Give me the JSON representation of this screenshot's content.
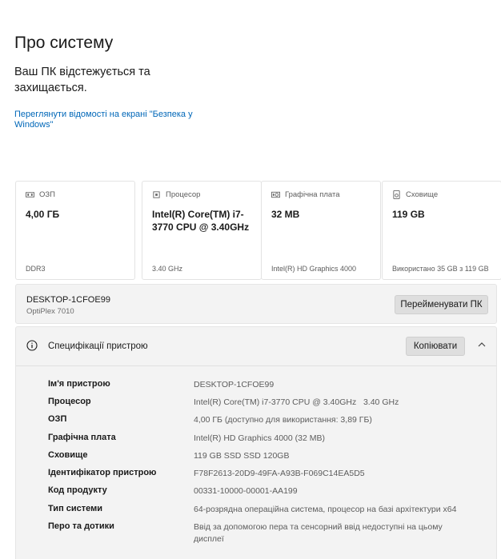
{
  "page": {
    "title": "Про систему",
    "protection_text": "Ваш ПК відстежується та захищається.",
    "security_link": "Переглянути відомості на екрані \"Безпека у Windows\""
  },
  "cards": [
    {
      "label": "ОЗП",
      "icon": "ram-icon",
      "value": "4,00 ГБ",
      "sub": "DDR3"
    },
    {
      "label": "Процесор",
      "icon": "processor-icon",
      "value": "Intel(R) Core(TM) i7-3770 CPU @ 3.40GHz",
      "sub": "3.40 GHz"
    },
    {
      "label": "Графічна плата",
      "icon": "graphics-card-icon",
      "value": "32 MB",
      "sub": "Intel(R) HD Graphics 4000"
    },
    {
      "label": "Сховище",
      "icon": "storage-icon",
      "value": "119 GB",
      "sub": "Використано 35 GB з 119 GB"
    }
  ],
  "device": {
    "name": "DESKTOP-1CFOE99",
    "model": "OptiPlex 7010",
    "rename_label": "Перейменувати ПК"
  },
  "specs": {
    "title": "Специфікації пристрою",
    "copy_label": "Копіювати",
    "rows": [
      {
        "label": "Ім'я пристрою",
        "value": "DESKTOP-1CFOE99"
      },
      {
        "label": "Процесор",
        "value": "Intel(R) Core(TM) i7-3770 CPU @ 3.40GHz   3.40 GHz"
      },
      {
        "label": "ОЗП",
        "value": "4,00 ГБ (доступно для використання: 3,89 ГБ)"
      },
      {
        "label": "Графічна плата",
        "value": "Intel(R) HD Graphics 4000 (32 MB)"
      },
      {
        "label": "Сховище",
        "value": "119 GB SSD SSD 120GB"
      },
      {
        "label": "Ідентифікатор пристрою",
        "value": "F78F2613-20D9-49FA-A93B-F069C14EA5D5"
      },
      {
        "label": "Код продукту",
        "value": "00331-10000-00001-AA199"
      },
      {
        "label": "Тип системи",
        "value": "64-розрядна операційна система, процесор на базі архітектури x64"
      },
      {
        "label": "Перо та дотики",
        "value": "Ввід за допомогою пера та сенсорний ввід недоступні на цьому дисплеї"
      }
    ]
  },
  "colors": {
    "link": "#0067b8",
    "panel_bg": "#f3f3f3",
    "button_bg": "#dedede"
  }
}
